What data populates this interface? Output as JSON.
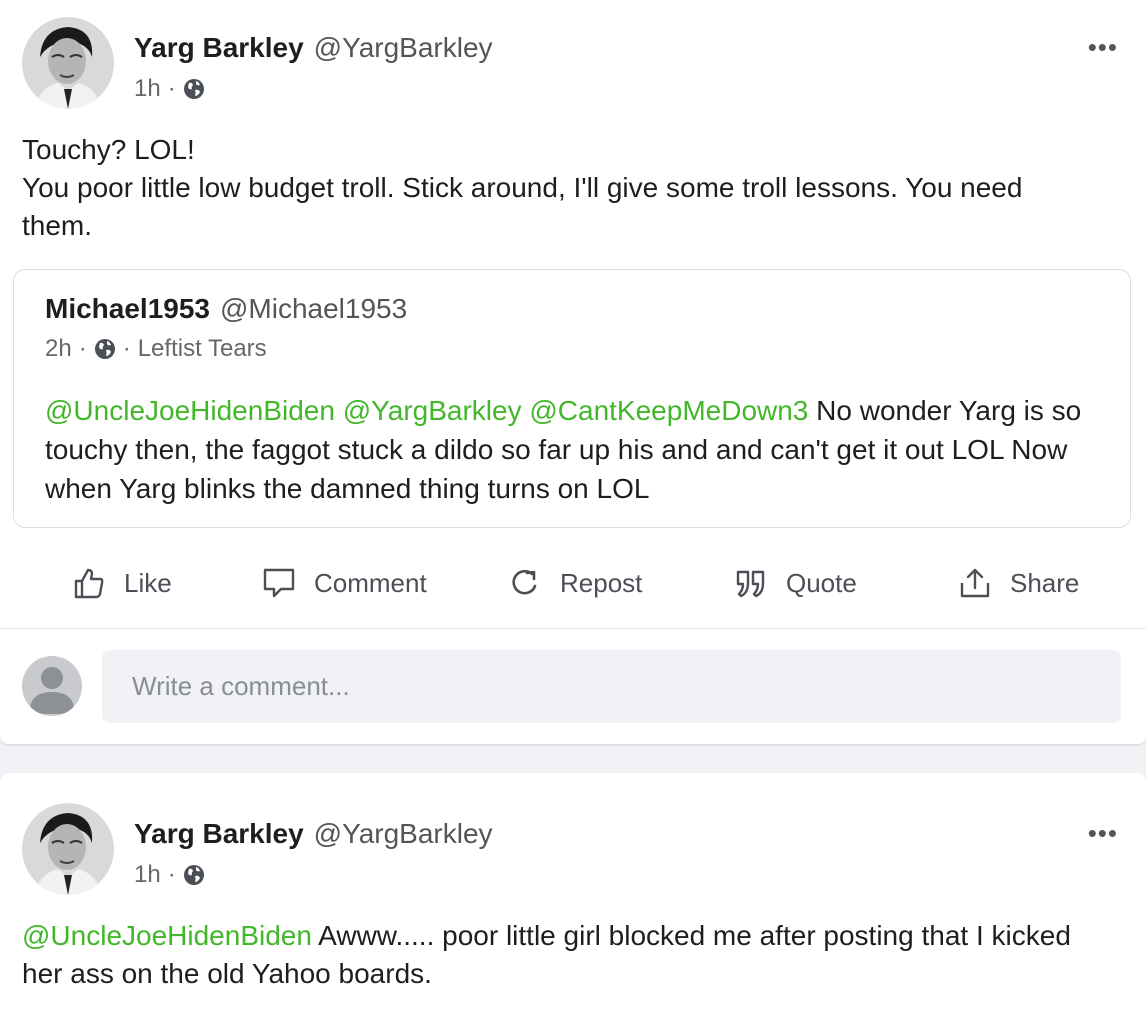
{
  "posts": [
    {
      "author_name": "Yarg Barkley",
      "author_handle": "@YargBarkley",
      "time": "1h",
      "separator": "·",
      "more_label": "•••",
      "text_lines": [
        "Touchy? LOL!",
        "You poor little low budget troll. Stick around, I'll give some troll lessons. You need them."
      ],
      "quoted": {
        "author_name": "Michael1953",
        "author_handle": "@Michael1953",
        "time": "2h",
        "separator": "·",
        "group": "Leftist Tears",
        "mentions": [
          "@UncleJoeHidenBiden",
          "@YargBarkley",
          "@CantKeepMeDown3"
        ],
        "text": "No wonder Yarg is so touchy then, the faggot stuck a dildo so far up his and and can't get it out LOL Now when Yarg blinks the damned thing turns on LOL"
      },
      "actions": {
        "like": "Like",
        "comment": "Comment",
        "repost": "Repost",
        "quote": "Quote",
        "share": "Share"
      },
      "comment_placeholder": "Write a comment..."
    },
    {
      "author_name": "Yarg Barkley",
      "author_handle": "@YargBarkley",
      "time": "1h",
      "separator": "·",
      "more_label": "•••",
      "mention": "@UncleJoeHidenBiden",
      "text": "Awww..... poor little girl blocked me after posting that I kicked her ass on the old Yahoo boards."
    }
  ],
  "colors": {
    "mention": "#42b72a",
    "background": "#f0f2f5",
    "card": "#ffffff"
  },
  "icons": {
    "globe": "globe-icon",
    "like": "thumbs-up-icon",
    "comment": "comment-bubble-icon",
    "repost": "repost-icon",
    "quote": "quote-marks-icon",
    "share": "share-upload-icon",
    "more": "more-horizontal-icon",
    "default_avatar": "person-icon"
  }
}
